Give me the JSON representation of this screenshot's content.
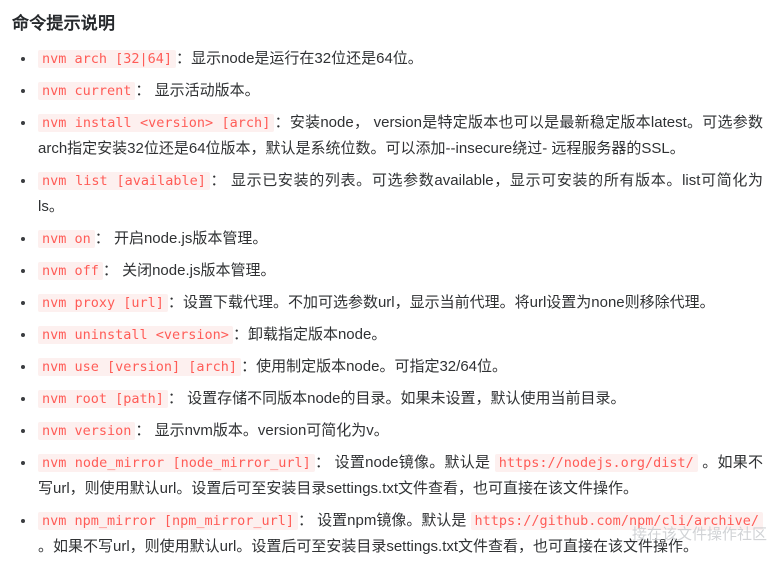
{
  "document": {
    "title": "命令提示说明",
    "separator": "：",
    "watermark": "接在该文件操作社区"
  },
  "commands": [
    {
      "code": "nvm arch [32|64]",
      "parts": [
        {
          "type": "text",
          "value": "显示node是运行在32位还是64位。"
        }
      ]
    },
    {
      "code": "nvm current",
      "parts": [
        {
          "type": "text",
          "value": " 显示活动版本。"
        }
      ]
    },
    {
      "code": "nvm install <version> [arch]",
      "parts": [
        {
          "type": "text",
          "value": "安装node， version是特定版本也可以是最新稳定版本latest。可选参数arch指定安装32位还是64位版本，默认是系统位数。可以添加--insecure绕过- 远程服务器的SSL。"
        }
      ]
    },
    {
      "code": "nvm list [available]",
      "parts": [
        {
          "type": "text",
          "value": " 显示已安装的列表。可选参数available，显示可安装的所有版本。list可简化为ls。"
        }
      ]
    },
    {
      "code": "nvm on",
      "parts": [
        {
          "type": "text",
          "value": " 开启node.js版本管理。"
        }
      ]
    },
    {
      "code": "nvm off",
      "parts": [
        {
          "type": "text",
          "value": " 关闭node.js版本管理。"
        }
      ]
    },
    {
      "code": "nvm proxy [url]",
      "parts": [
        {
          "type": "text",
          "value": "设置下载代理。不加可选参数url，显示当前代理。将url设置为none则移除代理。"
        }
      ]
    },
    {
      "code": "nvm uninstall <version>",
      "parts": [
        {
          "type": "text",
          "value": "卸载指定版本node。"
        }
      ]
    },
    {
      "code": "nvm use [version] [arch]",
      "parts": [
        {
          "type": "text",
          "value": "使用制定版本node。可指定32/64位。"
        }
      ]
    },
    {
      "code": "nvm root [path]",
      "parts": [
        {
          "type": "text",
          "value": " 设置存储不同版本node的目录。如果未设置，默认使用当前目录。"
        }
      ]
    },
    {
      "code": "nvm version",
      "parts": [
        {
          "type": "text",
          "value": " 显示nvm版本。version可简化为v。"
        }
      ]
    },
    {
      "code": "nvm node_mirror [node_mirror_url]",
      "parts": [
        {
          "type": "text",
          "value": " 设置node镜像。默认是 "
        },
        {
          "type": "code",
          "value": "https://nodejs.org/dist/"
        },
        {
          "type": "text",
          "value": " 。如果不写url，则使用默认url。设置后可至安装目录settings.txt文件查看，也可直接在该文件操作。"
        }
      ]
    },
    {
      "code": "nvm npm_mirror [npm_mirror_url]",
      "parts": [
        {
          "type": "text",
          "value": " 设置npm镜像。默认是 "
        },
        {
          "type": "code",
          "value": "https://github.com/npm/cli/archive/"
        },
        {
          "type": "text",
          "value": " 。如果不写url，则使用默认url。设置后可至安装目录settings.txt文件查看，也可直接在该文件操作。"
        }
      ]
    }
  ],
  "colors": {
    "code_text": "#ff5c57",
    "code_background": "#fdf0ef",
    "body_text": "#2f3133",
    "title_text": "#26292c",
    "bullet": "#3b3d40",
    "watermark": "#c9cccf",
    "page_background": "#ffffff"
  }
}
